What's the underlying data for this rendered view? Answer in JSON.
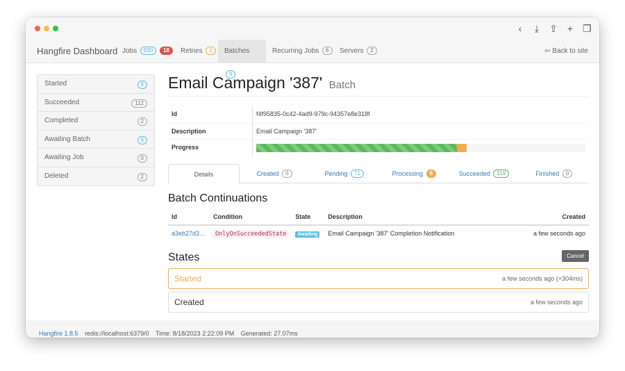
{
  "navbar": {
    "brand": "Hangfire Dashboard",
    "jobs_label": "Jobs",
    "jobs_count": "830",
    "jobs_failed": "18",
    "retries_label": "Retries",
    "retries_count": "1",
    "batches_label": "Batches",
    "batches_count": "9",
    "recurring_label": "Recurring Jobs",
    "recurring_count": "6",
    "servers_label": "Servers",
    "servers_count": "2",
    "back_label": "Back to site"
  },
  "sidebar": {
    "items": [
      {
        "label": "Started",
        "count": "9"
      },
      {
        "label": "Succeeded",
        "count": "112"
      },
      {
        "label": "Completed",
        "count": "2"
      },
      {
        "label": "Awaiting Batch",
        "count": "9"
      },
      {
        "label": "Awaiting Job",
        "count": "0"
      },
      {
        "label": "Deleted",
        "count": "2"
      }
    ]
  },
  "batch": {
    "title": "Email Campaign '387'",
    "subtitle": "Batch",
    "id_label": "Id",
    "id_value": "f4f95835-0c42-4ad9-979c-94357e8e318f",
    "desc_label": "Description",
    "desc_value": "Email Campaign '387'",
    "progress_label": "Progress",
    "progress_succeeded": 0.61,
    "progress_processing": 0.03
  },
  "tabs": [
    {
      "label": "Details"
    },
    {
      "label": "Created",
      "count": "0"
    },
    {
      "label": "Pending",
      "count": "71"
    },
    {
      "label": "Processing",
      "count": "6"
    },
    {
      "label": "Succeeded",
      "count": "119"
    },
    {
      "label": "Finished",
      "count": "0"
    }
  ],
  "continuations": {
    "heading": "Batch Continuations",
    "columns": [
      "Id",
      "Condition",
      "State",
      "Description",
      "Created"
    ],
    "rows": [
      {
        "id": "a3eb27d3…",
        "condition": "OnlyOnSucceededState",
        "state": "Awaiting",
        "description": "Email Campaign '387' Completion Notification",
        "created": "a few seconds ago"
      }
    ]
  },
  "states": {
    "heading": "States",
    "cancel_label": "Cancel",
    "items": [
      {
        "name": "Started",
        "time": "a few seconds ago (+304ms)"
      },
      {
        "name": "Created",
        "time": "a few seconds ago"
      }
    ]
  },
  "footer": {
    "version": "Hangfire 1.8.5",
    "storage": "redis://localhost:6379/0",
    "time": "Time: 8/18/2023 2:22:09 PM",
    "generated": "Generated: 27.07ms"
  },
  "colors": {
    "accent": "#337ab7",
    "success": "#5cb85c",
    "warning": "#f0ad4e",
    "danger": "#d9534f",
    "info": "#5bc0de"
  }
}
